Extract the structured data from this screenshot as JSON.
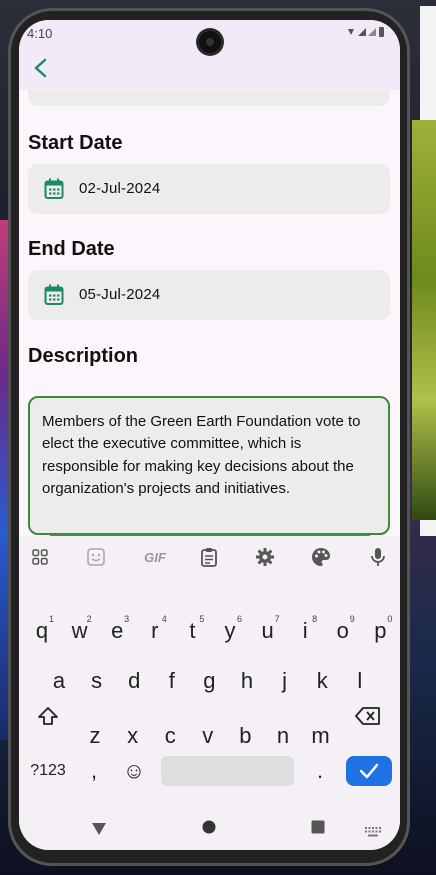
{
  "status_bar": {
    "time": "4:10",
    "icons_text": "▾◢◢▮"
  },
  "app_bar": {
    "back_icon": "arrow-back-icon"
  },
  "form": {
    "start_date": {
      "label": "Start Date",
      "value": "02-Jul-2024"
    },
    "end_date": {
      "label": "End Date",
      "value": "05-Jul-2024"
    },
    "description": {
      "label": "Description",
      "value": "Members of the Green Earth Foundation vote to elect the executive committee, which is responsible for making key decisions about the organization's projects and initiatives."
    }
  },
  "keyboard": {
    "toolbar": {
      "gif_label": "GIF"
    },
    "row1": [
      {
        "k": "q",
        "n": "1"
      },
      {
        "k": "w",
        "n": "2"
      },
      {
        "k": "e",
        "n": "3"
      },
      {
        "k": "r",
        "n": "4"
      },
      {
        "k": "t",
        "n": "5"
      },
      {
        "k": "y",
        "n": "6"
      },
      {
        "k": "u",
        "n": "7"
      },
      {
        "k": "i",
        "n": "8"
      },
      {
        "k": "o",
        "n": "9"
      },
      {
        "k": "p",
        "n": "0"
      }
    ],
    "row2": [
      "a",
      "s",
      "d",
      "f",
      "g",
      "h",
      "j",
      "k",
      "l"
    ],
    "row3": [
      "z",
      "x",
      "c",
      "v",
      "b",
      "n",
      "m"
    ],
    "symbols_label": "?123",
    "comma": ",",
    "period": ".",
    "emoji": "☺"
  },
  "colors": {
    "accent": "#3d8a3a",
    "enter_key": "#1f72e6",
    "teal_icon": "#1a8a6a"
  }
}
